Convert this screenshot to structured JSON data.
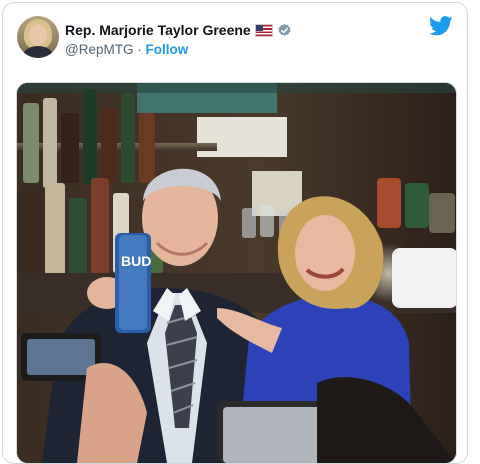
{
  "tweet": {
    "author_name": "Rep. Marjorie Taylor Greene",
    "handle": "@RepMTG",
    "separator": " · ",
    "follow_label": "Follow",
    "verified": true,
    "avatar_icon": "profile-photo",
    "brand_icon": "twitter-bird-icon"
  },
  "photo": {
    "can_text": "BUD"
  },
  "colors": {
    "accent": "#1d9bf0",
    "name_text": "#0f1419",
    "secondary_text": "#536471",
    "verified_badge": "#829aab"
  }
}
